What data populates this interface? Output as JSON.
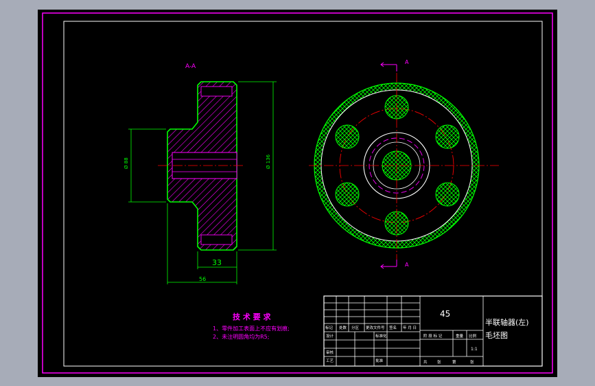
{
  "drawing": {
    "section_label": "A-A",
    "cut_label_top": "A",
    "cut_label_bottom": "A",
    "dims": {
      "hub_diameter": "Ø 88",
      "outer_diameter": "Ø 136",
      "flange_width": "33",
      "total_width": "56"
    }
  },
  "tech_requirements": {
    "title": "技 术 要 求",
    "items": [
      "1、零件加工表面上不应有划痕;",
      "2、未注明圆角均为R5;"
    ]
  },
  "title_block": {
    "material": "45",
    "part_name": "半联轴器(左)",
    "drawing_type": "毛坯图",
    "scale": "1:1",
    "cells": {
      "mark": "标记",
      "count": "处数",
      "zone": "分区",
      "change_doc": "更改文件号",
      "sign": "签名",
      "date": "年 月 日",
      "designer": "设计",
      "standardize": "标准化",
      "review": "审核",
      "process": "工艺",
      "approve": "批准",
      "stage_mark": "阶 段 标 记",
      "weight": "重量",
      "ratio": "比例",
      "total": "共",
      "sheet": "张",
      "no": "第"
    }
  },
  "colors": {
    "background": "#000000",
    "outline": "#00ff00",
    "hatch": "#ff00ff",
    "frame": "#ff00ff",
    "center": "#ff0000",
    "white": "#ffffff"
  }
}
